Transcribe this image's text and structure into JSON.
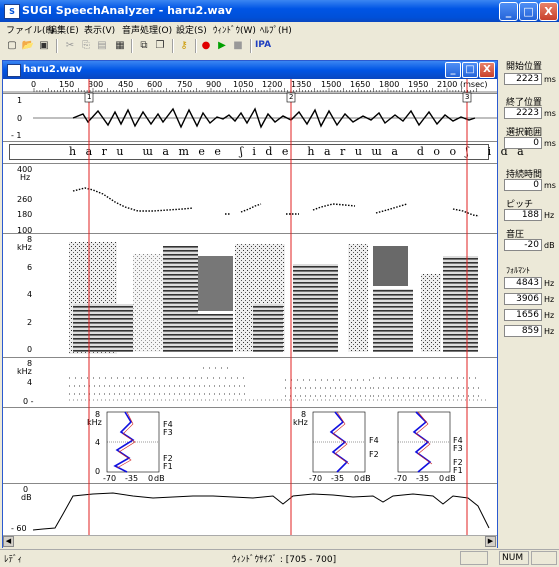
{
  "window": {
    "title": "SUGI SpeechAnalyzer - haru2.wav",
    "min_label": "_",
    "max_label": "□",
    "close_label": "X"
  },
  "menu": [
    "ファイル(F)",
    "編集(E)",
    "表示(V)",
    "音声処理(O)",
    "設定(S)",
    "ｳｨﾝﾄﾞｳ(W)",
    "ﾍﾙﾌﾟ(H)"
  ],
  "toolbar": {
    "icons": [
      "new-icon",
      "open-icon",
      "save-icon",
      "cut-icon",
      "copy-icon",
      "paste-icon",
      "settings-icon",
      "window-icon",
      "cascade-icon",
      "key-icon",
      "record-icon",
      "play-icon",
      "stop-icon"
    ],
    "ipa_label": "IPA"
  },
  "child": {
    "title": "haru2.wav",
    "time_ticks": [
      "0",
      "150",
      "300",
      "450",
      "600",
      "750",
      "900",
      "1050",
      "1200",
      "1350",
      "1500",
      "1650",
      "1800",
      "1950",
      "2100"
    ],
    "time_unit": "(msec)",
    "cursor_labels": [
      "1",
      "2",
      "3"
    ],
    "wave_labels": [
      "1",
      "0",
      "- 1"
    ],
    "transcription": "h a r u  ɯ a m e e  ʃ i d e  h a r u ɯ a  d o o ʃ  i d a",
    "pitch_labels": {
      "unit": "Hz",
      "top": "400",
      "v1": "260",
      "v2": "180",
      "v3": "100"
    },
    "spec_labels": {
      "unit": "kHz",
      "v8": "8",
      "v6": "6",
      "v4": "4",
      "v2": "2",
      "v0": "0"
    },
    "formant_labels": {
      "unit": "kHz",
      "v8": "8",
      "v4": "4",
      "v0": "0 -"
    },
    "lpc": {
      "unit": "kHz",
      "v8": "8",
      "v4": "4",
      "v0": "0",
      "x_ticks": [
        "-70",
        "-35",
        "0",
        "dB"
      ],
      "marks": [
        "F4",
        "F3",
        "F2",
        "F1"
      ]
    },
    "power_labels": {
      "unit": "dB",
      "v0": "0",
      "v60": "- 60"
    }
  },
  "side": {
    "start_label": "開始位置",
    "start_value": "2223",
    "start_unit": "ms",
    "end_label": "終了位置",
    "end_value": "2223",
    "end_unit": "ms",
    "sel_label": "選択範囲",
    "sel_value": "0",
    "sel_unit": "ms",
    "dur_label": "持続時間",
    "dur_value": "0",
    "dur_unit": "ms",
    "pitch_label": "ピッチ",
    "pitch_value": "188",
    "pitch_unit": "Hz",
    "power_label": "音圧",
    "power_value": "-20",
    "power_unit": "dB",
    "formant_label": "ﾌｫﾙﾏﾝﾄ",
    "formants": [
      "4843",
      "3906",
      "1656",
      "859"
    ],
    "formant_unit": "Hz"
  },
  "status": {
    "left": "ﾚﾃﾞｨ",
    "middle": "ｳｨﾝﾄﾞｳｻｲｽﾞ : [705 - 700]",
    "num": "NUM"
  },
  "colors": {
    "cursor": "#e02020",
    "title": "#0055e5",
    "lpc_blue": "#1010e0"
  }
}
